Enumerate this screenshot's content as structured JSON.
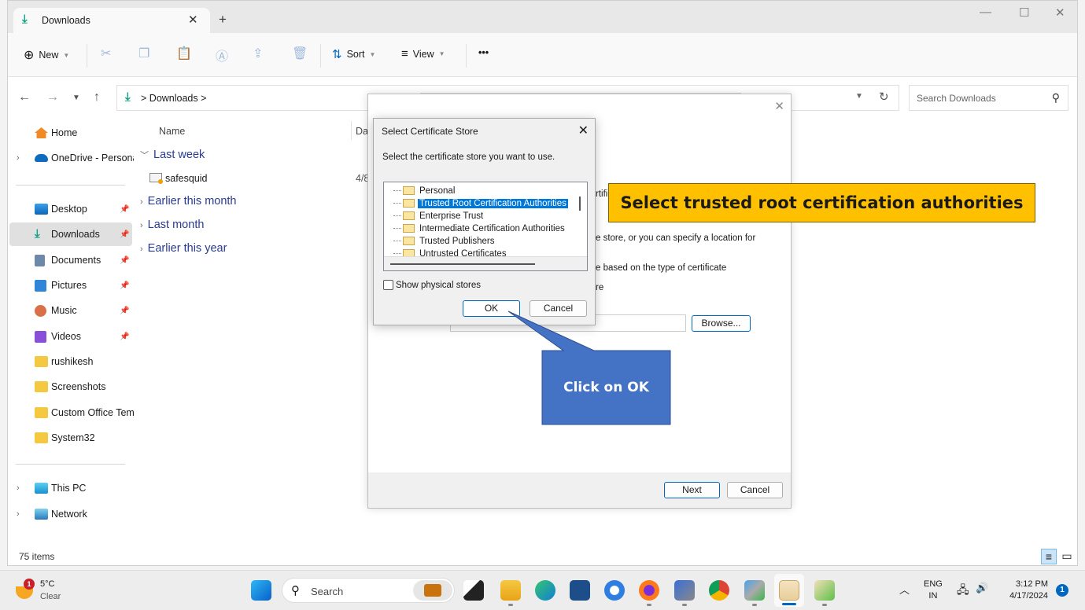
{
  "window": {
    "tab_title": "Downloads",
    "tab_icon": "download-icon",
    "new_tab_label": "+",
    "controls": [
      "minimize",
      "maximize",
      "close"
    ]
  },
  "toolbar": {
    "new_label": "New",
    "sort_label": "Sort",
    "view_label": "View",
    "more_label": "•••",
    "icons": [
      "cut-icon",
      "copy-icon",
      "paste-icon",
      "rename-icon",
      "share-icon",
      "delete-icon"
    ]
  },
  "address": {
    "path": "Downloads",
    "separator": ">",
    "search_placeholder": "Search Downloads"
  },
  "sidebar": {
    "items": [
      {
        "label": "Home",
        "icon": "home-icon",
        "expandable": false,
        "pinned": false
      },
      {
        "label": "OneDrive - Persona",
        "icon": "onedrive-icon",
        "expandable": true,
        "pinned": false
      },
      {
        "label": "Desktop",
        "icon": "desktop-icon",
        "pinned": true
      },
      {
        "label": "Downloads",
        "icon": "download-icon",
        "pinned": true,
        "selected": true
      },
      {
        "label": "Documents",
        "icon": "documents-icon",
        "pinned": true
      },
      {
        "label": "Pictures",
        "icon": "pictures-icon",
        "pinned": true
      },
      {
        "label": "Music",
        "icon": "music-icon",
        "pinned": true
      },
      {
        "label": "Videos",
        "icon": "videos-icon",
        "pinned": true
      },
      {
        "label": "rushikesh",
        "icon": "folder-icon"
      },
      {
        "label": "Screenshots",
        "icon": "folder-icon"
      },
      {
        "label": "Custom Office Tem",
        "icon": "folder-icon"
      },
      {
        "label": "System32",
        "icon": "folder-icon"
      },
      {
        "label": "This PC",
        "icon": "pc-icon",
        "expandable": true
      },
      {
        "label": "Network",
        "icon": "network-icon",
        "expandable": true
      }
    ]
  },
  "file_list": {
    "columns": [
      "Name",
      "Dat"
    ],
    "groups": [
      {
        "label": "Last week",
        "expanded": true,
        "files": [
          {
            "name": "safesquid",
            "date": "4/8"
          }
        ]
      },
      {
        "label": "Earlier this month",
        "expanded": false
      },
      {
        "label": "Last month",
        "expanded": false
      },
      {
        "label": "Earlier this year",
        "expanded": false
      }
    ],
    "status": "75 items"
  },
  "wizard": {
    "partial_text_1": "rtific",
    "partial_text_2": "e store, or you can specify a location for",
    "partial_text_3": "e based on the type of certificate",
    "partial_text_4": "re",
    "browse_label": "Browse...",
    "next_label": "Next",
    "cancel_label": "Cancel"
  },
  "store_dialog": {
    "title": "Select Certificate Store",
    "prompt": "Select the certificate store you want to use.",
    "stores": [
      {
        "label": "Personal",
        "selected": false
      },
      {
        "label": "Trusted Root Certification Authorities",
        "selected": true
      },
      {
        "label": "Enterprise Trust",
        "selected": false
      },
      {
        "label": "Intermediate Certification Authorities",
        "selected": false
      },
      {
        "label": "Trusted Publishers",
        "selected": false
      },
      {
        "label": "Untrusted Certificates",
        "selected": false
      }
    ],
    "show_physical_label": "Show physical stores",
    "show_physical_checked": false,
    "ok_label": "OK",
    "cancel_label": "Cancel"
  },
  "annotations": {
    "yellow_callout": "Select trusted root certification authorities",
    "blue_callout": "Click on OK",
    "yellow_color": "#ffc000",
    "blue_color": "#4472c4"
  },
  "taskbar": {
    "weather_temp": "5°C",
    "weather_desc": "Clear",
    "weather_badge": "1",
    "search_label": "Search",
    "apps": [
      "work-icon",
      "task-view-icon",
      "file-explorer-icon",
      "edge-icon",
      "store-icon",
      "thunderbird-icon",
      "firefox-icon",
      "remote-desktop-icon",
      "chrome-icon",
      "security-icon",
      "certificate-icon",
      "cert-import-icon"
    ],
    "lang_top": "ENG",
    "lang_bottom": "IN",
    "time": "3:12 PM",
    "date": "4/17/2024",
    "notification_count": "1"
  }
}
